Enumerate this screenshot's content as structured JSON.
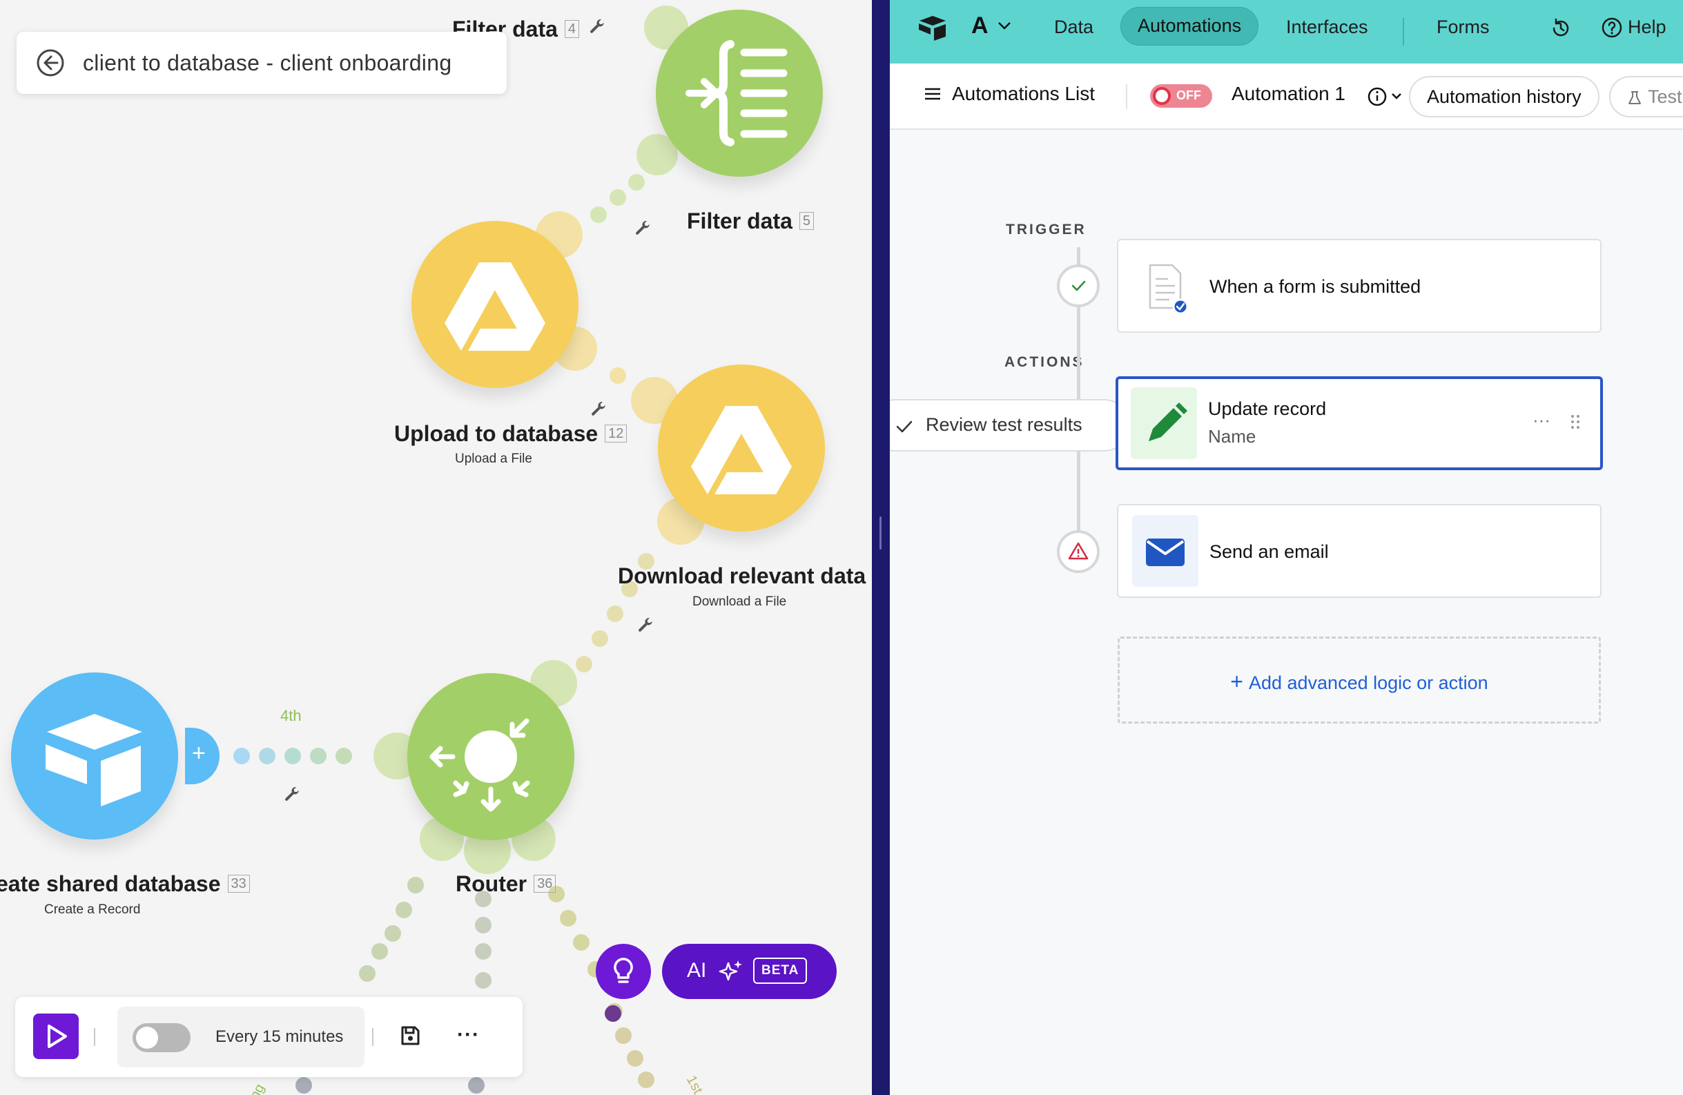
{
  "scenario": {
    "breadcrumb_title": "client to database - client onboarding",
    "modules": [
      {
        "name": "Filter data",
        "number": "4",
        "subtitle": ""
      },
      {
        "name": "Filter data",
        "number": "5",
        "subtitle": ""
      },
      {
        "name": "Upload to database",
        "number": "12",
        "subtitle": "Upload a File"
      },
      {
        "name": "Download relevant data",
        "number": "",
        "subtitle": "Download a File"
      },
      {
        "name": "eate shared database",
        "number": "33",
        "subtitle": "Create a Record"
      },
      {
        "name": "Router",
        "number": "36",
        "subtitle": ""
      }
    ],
    "route_labels": {
      "fourth": "4th",
      "first": "1st",
      "partial": "ng"
    },
    "toolbar": {
      "schedule": "Every 15 minutes"
    },
    "ai": {
      "label": "AI",
      "badge": "BETA"
    },
    "colors": {
      "filter_green": "#a3cf68",
      "drive_yellow": "#f6ce5b",
      "airtable_blue": "#5bbcf6",
      "purple": "#6d19d6"
    }
  },
  "airtable": {
    "nav": {
      "base_letter": "A",
      "items": [
        "Data",
        "Automations",
        "Interfaces",
        "Forms"
      ],
      "active": "Automations",
      "help": "Help"
    },
    "subbar": {
      "list_label": "Automations List",
      "toggle_label": "OFF",
      "automation_name": "Automation 1",
      "history_label": "Automation history",
      "test_label": "Test"
    },
    "trigger_label": "TRIGGER",
    "actions_label": "ACTIONS",
    "trigger": {
      "title": "When a form is submitted"
    },
    "actions": [
      {
        "title": "Update record",
        "subtitle": "Name"
      },
      {
        "title": "Send an email",
        "subtitle": ""
      }
    ],
    "review_label": "Review test results",
    "add_label": "Add advanced logic or action",
    "colors": {
      "nav_bg": "#5ed4cf",
      "selected_border": "#2a55c8",
      "link": "#1e5fd6"
    }
  }
}
